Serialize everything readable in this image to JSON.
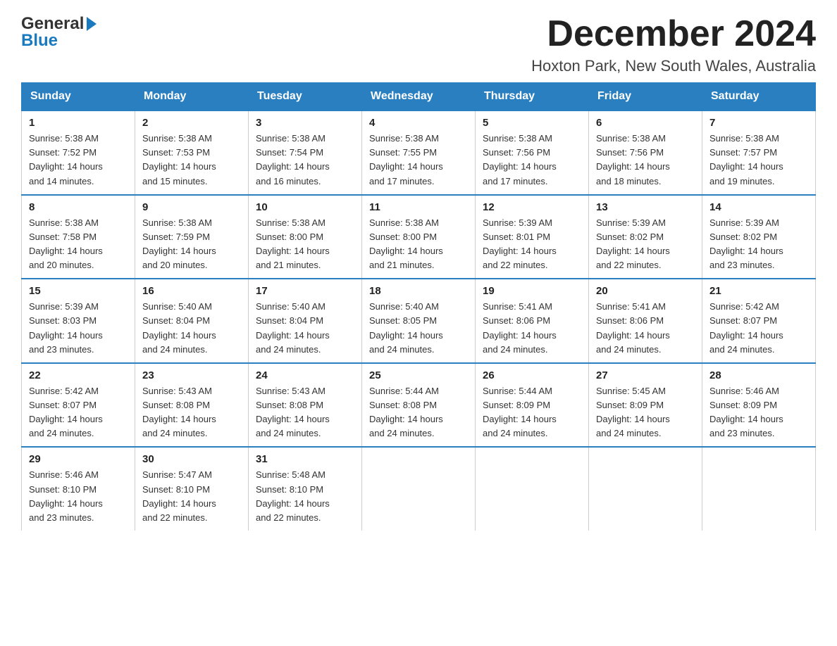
{
  "logo": {
    "line1": "General",
    "line2": "Blue",
    "arrow": "▶"
  },
  "title": "December 2024",
  "location": "Hoxton Park, New South Wales, Australia",
  "days_of_week": [
    "Sunday",
    "Monday",
    "Tuesday",
    "Wednesday",
    "Thursday",
    "Friday",
    "Saturday"
  ],
  "weeks": [
    [
      {
        "day": "1",
        "sunrise": "5:38 AM",
        "sunset": "7:52 PM",
        "daylight": "14 hours and 14 minutes."
      },
      {
        "day": "2",
        "sunrise": "5:38 AM",
        "sunset": "7:53 PM",
        "daylight": "14 hours and 15 minutes."
      },
      {
        "day": "3",
        "sunrise": "5:38 AM",
        "sunset": "7:54 PM",
        "daylight": "14 hours and 16 minutes."
      },
      {
        "day": "4",
        "sunrise": "5:38 AM",
        "sunset": "7:55 PM",
        "daylight": "14 hours and 17 minutes."
      },
      {
        "day": "5",
        "sunrise": "5:38 AM",
        "sunset": "7:56 PM",
        "daylight": "14 hours and 17 minutes."
      },
      {
        "day": "6",
        "sunrise": "5:38 AM",
        "sunset": "7:56 PM",
        "daylight": "14 hours and 18 minutes."
      },
      {
        "day": "7",
        "sunrise": "5:38 AM",
        "sunset": "7:57 PM",
        "daylight": "14 hours and 19 minutes."
      }
    ],
    [
      {
        "day": "8",
        "sunrise": "5:38 AM",
        "sunset": "7:58 PM",
        "daylight": "14 hours and 20 minutes."
      },
      {
        "day": "9",
        "sunrise": "5:38 AM",
        "sunset": "7:59 PM",
        "daylight": "14 hours and 20 minutes."
      },
      {
        "day": "10",
        "sunrise": "5:38 AM",
        "sunset": "8:00 PM",
        "daylight": "14 hours and 21 minutes."
      },
      {
        "day": "11",
        "sunrise": "5:38 AM",
        "sunset": "8:00 PM",
        "daylight": "14 hours and 21 minutes."
      },
      {
        "day": "12",
        "sunrise": "5:39 AM",
        "sunset": "8:01 PM",
        "daylight": "14 hours and 22 minutes."
      },
      {
        "day": "13",
        "sunrise": "5:39 AM",
        "sunset": "8:02 PM",
        "daylight": "14 hours and 22 minutes."
      },
      {
        "day": "14",
        "sunrise": "5:39 AM",
        "sunset": "8:02 PM",
        "daylight": "14 hours and 23 minutes."
      }
    ],
    [
      {
        "day": "15",
        "sunrise": "5:39 AM",
        "sunset": "8:03 PM",
        "daylight": "14 hours and 23 minutes."
      },
      {
        "day": "16",
        "sunrise": "5:40 AM",
        "sunset": "8:04 PM",
        "daylight": "14 hours and 24 minutes."
      },
      {
        "day": "17",
        "sunrise": "5:40 AM",
        "sunset": "8:04 PM",
        "daylight": "14 hours and 24 minutes."
      },
      {
        "day": "18",
        "sunrise": "5:40 AM",
        "sunset": "8:05 PM",
        "daylight": "14 hours and 24 minutes."
      },
      {
        "day": "19",
        "sunrise": "5:41 AM",
        "sunset": "8:06 PM",
        "daylight": "14 hours and 24 minutes."
      },
      {
        "day": "20",
        "sunrise": "5:41 AM",
        "sunset": "8:06 PM",
        "daylight": "14 hours and 24 minutes."
      },
      {
        "day": "21",
        "sunrise": "5:42 AM",
        "sunset": "8:07 PM",
        "daylight": "14 hours and 24 minutes."
      }
    ],
    [
      {
        "day": "22",
        "sunrise": "5:42 AM",
        "sunset": "8:07 PM",
        "daylight": "14 hours and 24 minutes."
      },
      {
        "day": "23",
        "sunrise": "5:43 AM",
        "sunset": "8:08 PM",
        "daylight": "14 hours and 24 minutes."
      },
      {
        "day": "24",
        "sunrise": "5:43 AM",
        "sunset": "8:08 PM",
        "daylight": "14 hours and 24 minutes."
      },
      {
        "day": "25",
        "sunrise": "5:44 AM",
        "sunset": "8:08 PM",
        "daylight": "14 hours and 24 minutes."
      },
      {
        "day": "26",
        "sunrise": "5:44 AM",
        "sunset": "8:09 PM",
        "daylight": "14 hours and 24 minutes."
      },
      {
        "day": "27",
        "sunrise": "5:45 AM",
        "sunset": "8:09 PM",
        "daylight": "14 hours and 24 minutes."
      },
      {
        "day": "28",
        "sunrise": "5:46 AM",
        "sunset": "8:09 PM",
        "daylight": "14 hours and 23 minutes."
      }
    ],
    [
      {
        "day": "29",
        "sunrise": "5:46 AM",
        "sunset": "8:10 PM",
        "daylight": "14 hours and 23 minutes."
      },
      {
        "day": "30",
        "sunrise": "5:47 AM",
        "sunset": "8:10 PM",
        "daylight": "14 hours and 22 minutes."
      },
      {
        "day": "31",
        "sunrise": "5:48 AM",
        "sunset": "8:10 PM",
        "daylight": "14 hours and 22 minutes."
      },
      null,
      null,
      null,
      null
    ]
  ],
  "labels": {
    "sunrise": "Sunrise:",
    "sunset": "Sunset:",
    "daylight": "Daylight:"
  }
}
